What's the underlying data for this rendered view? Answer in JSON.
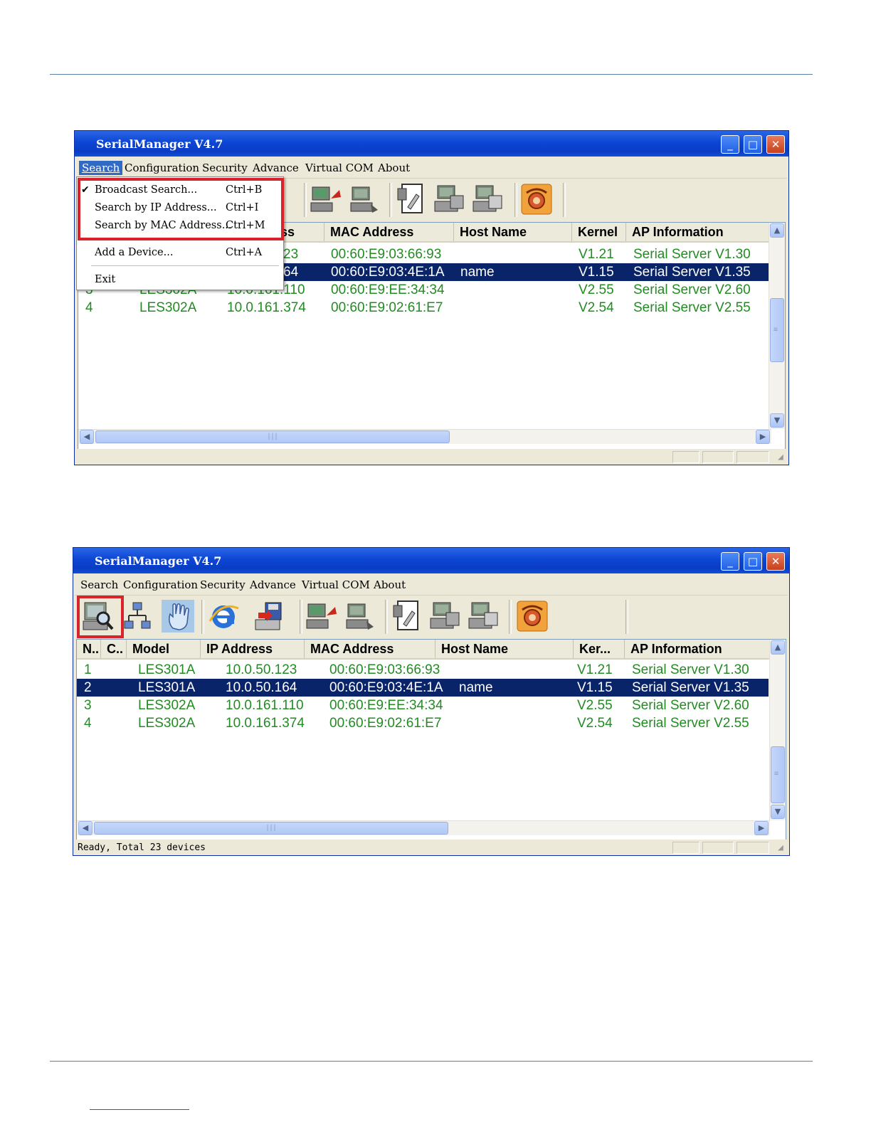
{
  "window": {
    "title": "SerialManager V4.7",
    "controls": {
      "minimize": "_",
      "maximize": "□",
      "close": "✕"
    }
  },
  "menu": {
    "items": [
      "Search",
      "Configuration",
      "Security",
      "Advance",
      "Virtual COM",
      "About"
    ],
    "active": "Search"
  },
  "search_menu": {
    "items": [
      {
        "label": "Broadcast Search...",
        "shortcut": "Ctrl+B",
        "checked": true
      },
      {
        "label": "Search by IP Address...",
        "shortcut": "Ctrl+I"
      },
      {
        "label": "Search by MAC Address...",
        "shortcut": "Ctrl+M"
      },
      {
        "label": "Add a Device...",
        "shortcut": "Ctrl+A"
      },
      {
        "label": "Exit",
        "shortcut": ""
      }
    ]
  },
  "toolbar": {
    "icons": [
      "search-device-icon",
      "network-icon",
      "hand-pointer-icon",
      "web-browser-icon",
      "firmware-upgrade-icon",
      "reboot-icon",
      "reset-icon",
      "configure-icon",
      "export-config-icon",
      "import-config-icon",
      "telephone-icon"
    ]
  },
  "top_window": {
    "columns": {
      "ip_partial": "ss",
      "mac": "MAC Address",
      "host": "Host Name",
      "kernel": "Kernel",
      "ap": "AP Information"
    },
    "rows": [
      {
        "no": "",
        "model": "",
        "ip": "23",
        "mac": "00:60:E9:03:66:93",
        "host": "",
        "kernel": "V1.21",
        "ap": "Serial Server V1.30"
      },
      {
        "no": "",
        "model": "",
        "ip": "64",
        "mac": "00:60:E9:03:4E:1A",
        "host": "name",
        "kernel": "V1.15",
        "ap": "Serial Server V1.35"
      },
      {
        "no": "3",
        "model": "LES302A",
        "ip": "10.0.161.110",
        "mac": "00:60:E9:EE:34:34",
        "host": "",
        "kernel": "V2.55",
        "ap": "Serial Server V2.60"
      },
      {
        "no": "4",
        "model": "LES302A",
        "ip": "10.0.161.374",
        "mac": "00:60:E9:02:61:E7",
        "host": "",
        "kernel": "V2.54",
        "ap": "Serial Server V2.55"
      }
    ]
  },
  "bottom_window": {
    "columns": {
      "no": "N..",
      "c": "C..",
      "model": "Model",
      "ip": "IP Address",
      "mac": "MAC Address",
      "host": "Host Name",
      "kernel": "Ker...",
      "ap": "AP Information"
    },
    "rows": [
      {
        "no": "1",
        "model": "LES301A",
        "ip": "10.0.50.123",
        "mac": "00:60:E9:03:66:93",
        "host": "",
        "kernel": "V1.21",
        "ap": "Serial Server V1.30"
      },
      {
        "no": "2",
        "model": "LES301A",
        "ip": "10.0.50.164",
        "mac": "00:60:E9:03:4E:1A",
        "host": "name",
        "kernel": "V1.15",
        "ap": "Serial Server V1.35"
      },
      {
        "no": "3",
        "model": "LES302A",
        "ip": "10.0.161.110",
        "mac": "00:60:E9:EE:34:34",
        "host": "",
        "kernel": "V2.55",
        "ap": "Serial Server V2.60"
      },
      {
        "no": "4",
        "model": "LES302A",
        "ip": "10.0.161.374",
        "mac": "00:60:E9:02:61:E7",
        "host": "",
        "kernel": "V2.54",
        "ap": "Serial Server V2.55"
      }
    ],
    "status": "Ready, Total 23 devices"
  },
  "colors": {
    "accent_red": "#d8232a",
    "row_text": "#228b22",
    "selected_row": "#0a246a",
    "titlebar": "#0c46d4"
  }
}
